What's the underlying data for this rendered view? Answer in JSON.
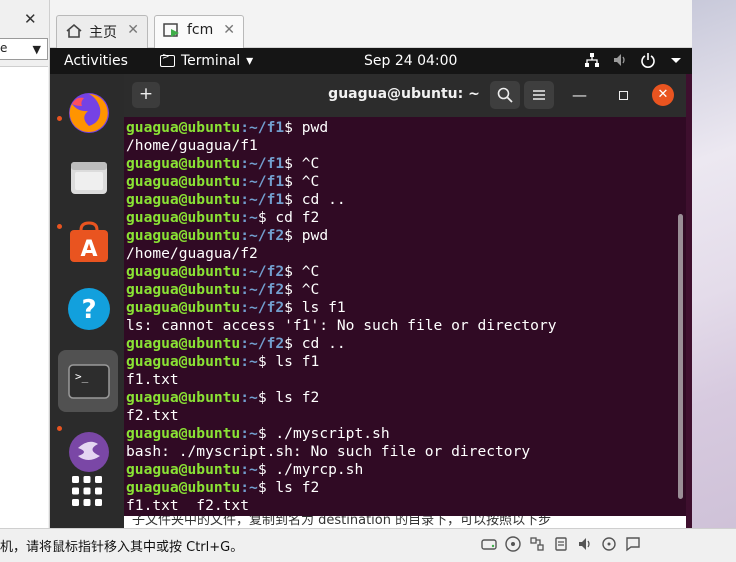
{
  "host": {
    "close_glyph": "✕",
    "combo_text": "e",
    "combo_arrow": "▼",
    "tabs": [
      {
        "label": "主页",
        "close": "✕"
      },
      {
        "label": "fcm",
        "close": "✕"
      }
    ],
    "status_hint": "机，请将鼠标指针移入其中或按 Ctrl+G。",
    "behind_text": "子文件夹中的文件，复制到名为 destination 的目录下，可以按照以下步"
  },
  "guest": {
    "topbar": {
      "activities": "Activities",
      "app_menu": "Terminal",
      "app_menu_arrow": "▾",
      "clock": "Sep 24  04:00"
    },
    "terminal": {
      "title": "guagua@ubuntu: ~",
      "new_tab": "+",
      "minimize": "—",
      "close": "✕",
      "lines": [
        {
          "user": "guagua@ubuntu",
          "path": ":~/f1",
          "cmd": "$ pwd"
        },
        {
          "out": "/home/guagua/f1"
        },
        {
          "user": "guagua@ubuntu",
          "path": ":~/f1",
          "cmd": "$ ^C"
        },
        {
          "user": "guagua@ubuntu",
          "path": ":~/f1",
          "cmd": "$ ^C"
        },
        {
          "user": "guagua@ubuntu",
          "path": ":~/f1",
          "cmd": "$ cd .."
        },
        {
          "user": "guagua@ubuntu",
          "path": ":~",
          "cmd": "$ cd f2"
        },
        {
          "user": "guagua@ubuntu",
          "path": ":~/f2",
          "cmd": "$ pwd"
        },
        {
          "out": "/home/guagua/f2"
        },
        {
          "user": "guagua@ubuntu",
          "path": ":~/f2",
          "cmd": "$ ^C"
        },
        {
          "user": "guagua@ubuntu",
          "path": ":~/f2",
          "cmd": "$ ^C"
        },
        {
          "user": "guagua@ubuntu",
          "path": ":~/f2",
          "cmd": "$ ls f1"
        },
        {
          "out": "ls: cannot access 'f1': No such file or directory"
        },
        {
          "user": "guagua@ubuntu",
          "path": ":~/f2",
          "cmd": "$ cd .."
        },
        {
          "user": "guagua@ubuntu",
          "path": ":~",
          "cmd": "$ ls f1"
        },
        {
          "out": "f1.txt"
        },
        {
          "user": "guagua@ubuntu",
          "path": ":~",
          "cmd": "$ ls f2"
        },
        {
          "out": "f2.txt"
        },
        {
          "user": "guagua@ubuntu",
          "path": ":~",
          "cmd": "$ ./myscript.sh"
        },
        {
          "out": "bash: ./myscript.sh: No such file or directory"
        },
        {
          "user": "guagua@ubuntu",
          "path": ":~",
          "cmd": "$ ./myrcp.sh"
        },
        {
          "user": "guagua@ubuntu",
          "path": ":~",
          "cmd": "$ ls f2"
        },
        {
          "out": "f1.txt  f2.txt"
        }
      ]
    },
    "dock": [
      {
        "name": "firefox-icon"
      },
      {
        "name": "files-icon"
      },
      {
        "name": "software-icon",
        "glyph": "A"
      },
      {
        "name": "help-icon",
        "glyph": "?"
      },
      {
        "name": "terminal-icon",
        "glyph": ">_"
      },
      {
        "name": "screenshot-icon"
      }
    ]
  },
  "colors": {
    "terminal_bg": "#300a24",
    "prompt_user": "#8ae234",
    "prompt_path": "#729fcf",
    "ubuntu_orange": "#e95420",
    "topbar": "#151515",
    "dock": "#2b2b2b"
  }
}
